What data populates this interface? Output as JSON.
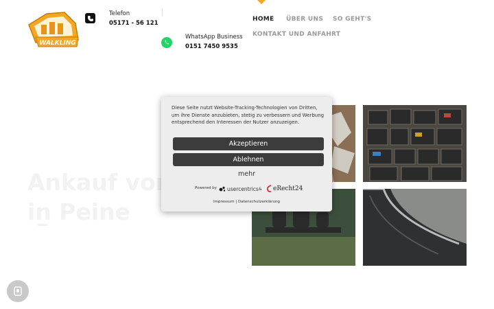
{
  "header": {
    "logo_text": "WALKLING",
    "phone": {
      "label": "Telefon",
      "number": "05171 - 56 121",
      "icon": "phone-icon"
    },
    "whatsapp": {
      "label": "WhatsApp Business",
      "number": "0151 7450 9535",
      "icon": "whatsapp-icon"
    }
  },
  "nav": {
    "items": [
      {
        "label": "HOME",
        "active": true
      },
      {
        "label": "ÜBER UNS",
        "active": false
      },
      {
        "label": "SO GEHT'S",
        "active": false
      },
      {
        "label": "KONTAKT UND ANFAHRT",
        "active": false
      }
    ]
  },
  "hero": {
    "title_line1": "Ankauf von",
    "title_line2": "in Peine"
  },
  "consent": {
    "text": "Diese Seite nutzt Website-Tracking-Technologien von Dritten, um ihre Dienste anzubieten, stetig zu verbessern und Werbung entsprechend den Interessen der Nutzer anzuzeigen.",
    "accept_label": "Akzeptieren",
    "decline_label": "Ablehnen",
    "more_label": "mehr",
    "powered_by": "Powered by",
    "provider_1": "usercentrics",
    "ampersand": "&",
    "provider_2": "eRecht24",
    "impressum": "Impressum",
    "separator": "|",
    "datenschutz": "Datenschutzerklärung"
  },
  "colors": {
    "accent": "#f5a623",
    "button": "#3c3c3c",
    "modal_bg": "#ededed",
    "whatsapp": "#25d366"
  }
}
